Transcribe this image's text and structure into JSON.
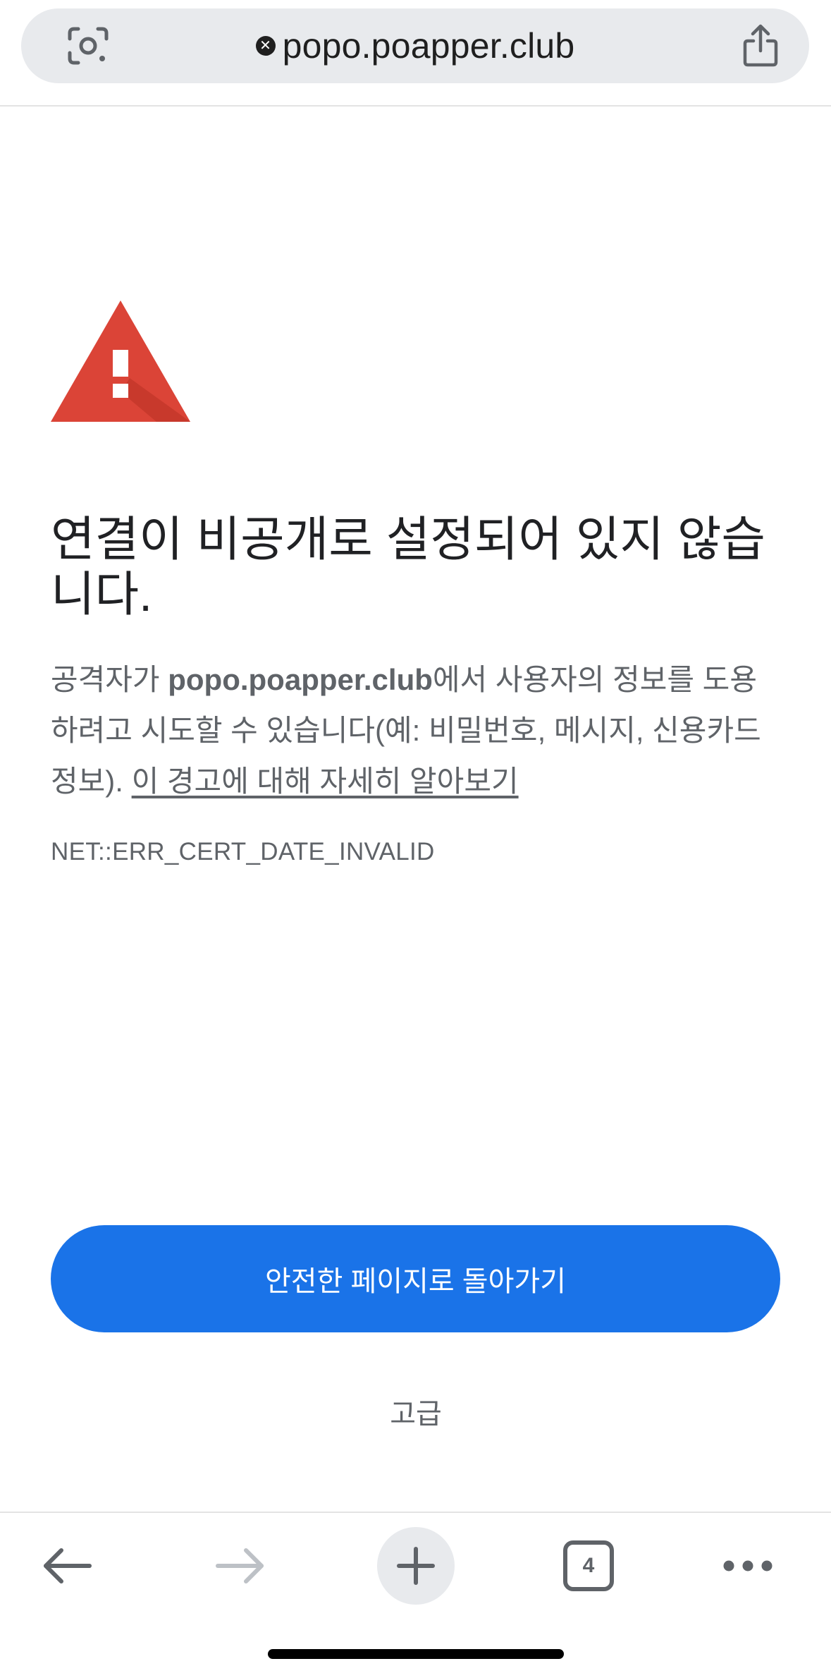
{
  "address_bar": {
    "url": "popo.poapper.club",
    "status_icon": "not-secure-x-icon",
    "left_icon": "google-lens-icon",
    "right_icon": "share-icon"
  },
  "interstitial": {
    "icon": "warning-triangle-icon",
    "heading": "연결이 비공개로 설정되어 있지 않습니다.",
    "body_prefix": "공격자가 ",
    "body_domain": "popo.poapper.club",
    "body_suffix": "에서 사용자의 정보를 도용하려고 시도할 수 있습니다(예: 비밀번호, 메시지, 신용카드 정보). ",
    "learn_more_link": "이 경고에 대해 자세히 알아보기",
    "error_code": "NET::ERR_CERT_DATE_INVALID",
    "primary_button": "안전한 페이지로 돌아가기",
    "advanced_button": "고급"
  },
  "toolbar": {
    "back_icon": "back-arrow-icon",
    "forward_icon": "forward-arrow-icon",
    "new_tab_icon": "plus-icon",
    "tab_count": "4",
    "menu_icon": "more-horizontal-icon"
  },
  "colors": {
    "accent": "#1a73e8",
    "warning_red": "#db4437",
    "text_primary": "#202124",
    "text_secondary": "#5f6368",
    "omnibox_bg": "#e8eaed"
  }
}
